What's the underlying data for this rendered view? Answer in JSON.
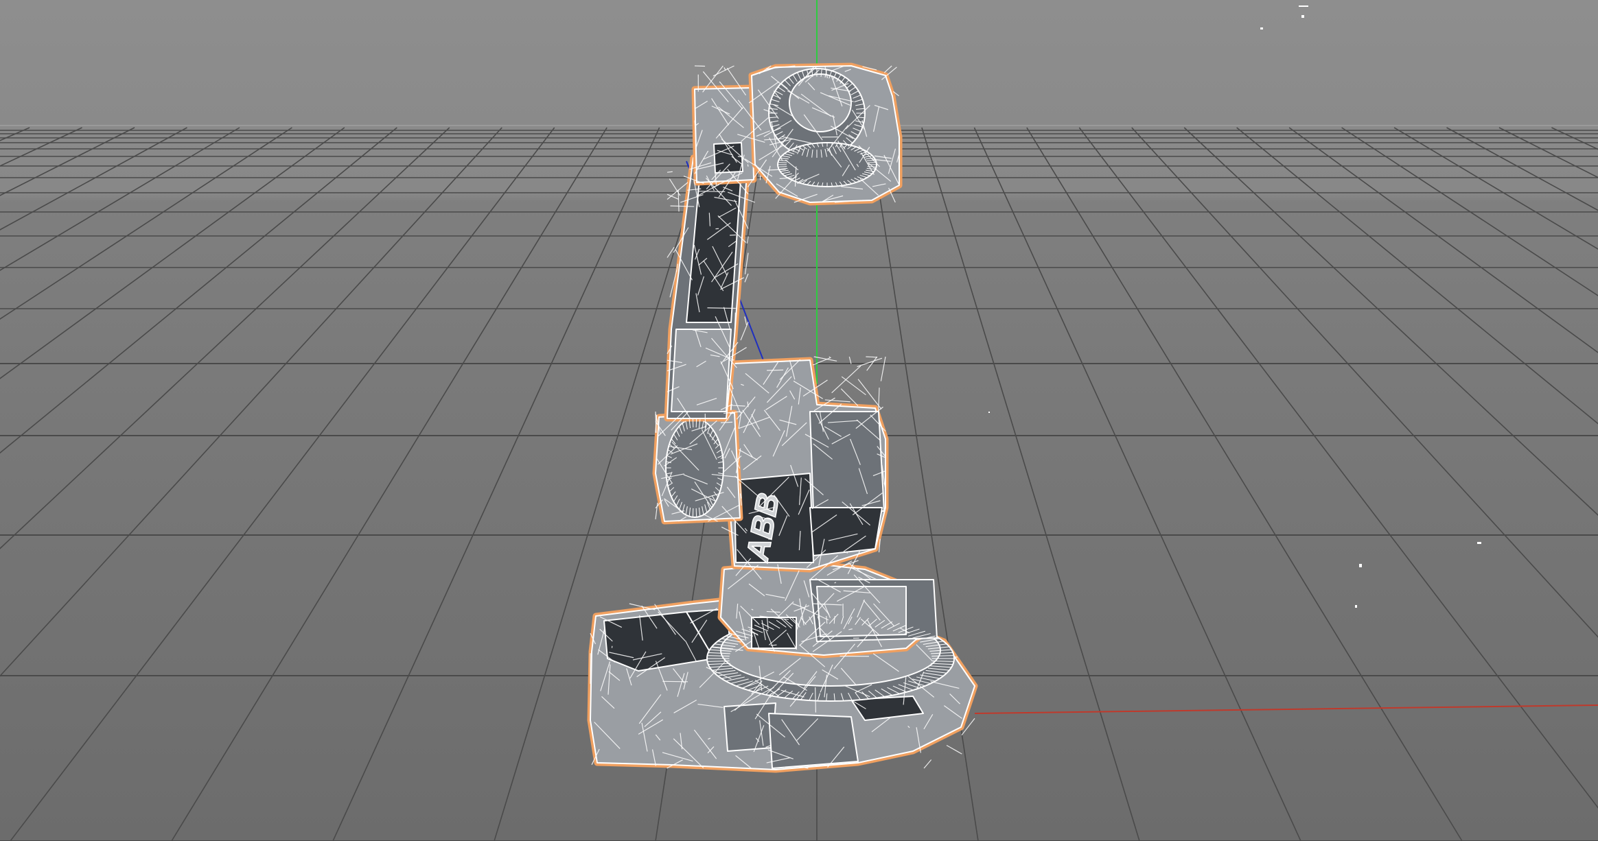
{
  "viewport": {
    "background_top": "#8c8c8c",
    "background_bottom": "#707070",
    "grid_color": "#4a4a4a",
    "horizon_line_color": "#9a9a9a"
  },
  "axes": {
    "x_axis_color": "#c0392b",
    "y_axis_color": "#2ecc40",
    "z_axis_color": "#1f2fbf"
  },
  "model": {
    "selection_outline_color": "#f0a060",
    "wire_color": "#ffffff",
    "face_light": "#9a9ea3",
    "face_mid": "#6d7278",
    "face_dark": "#2f3338",
    "logo_text": "ABB"
  }
}
